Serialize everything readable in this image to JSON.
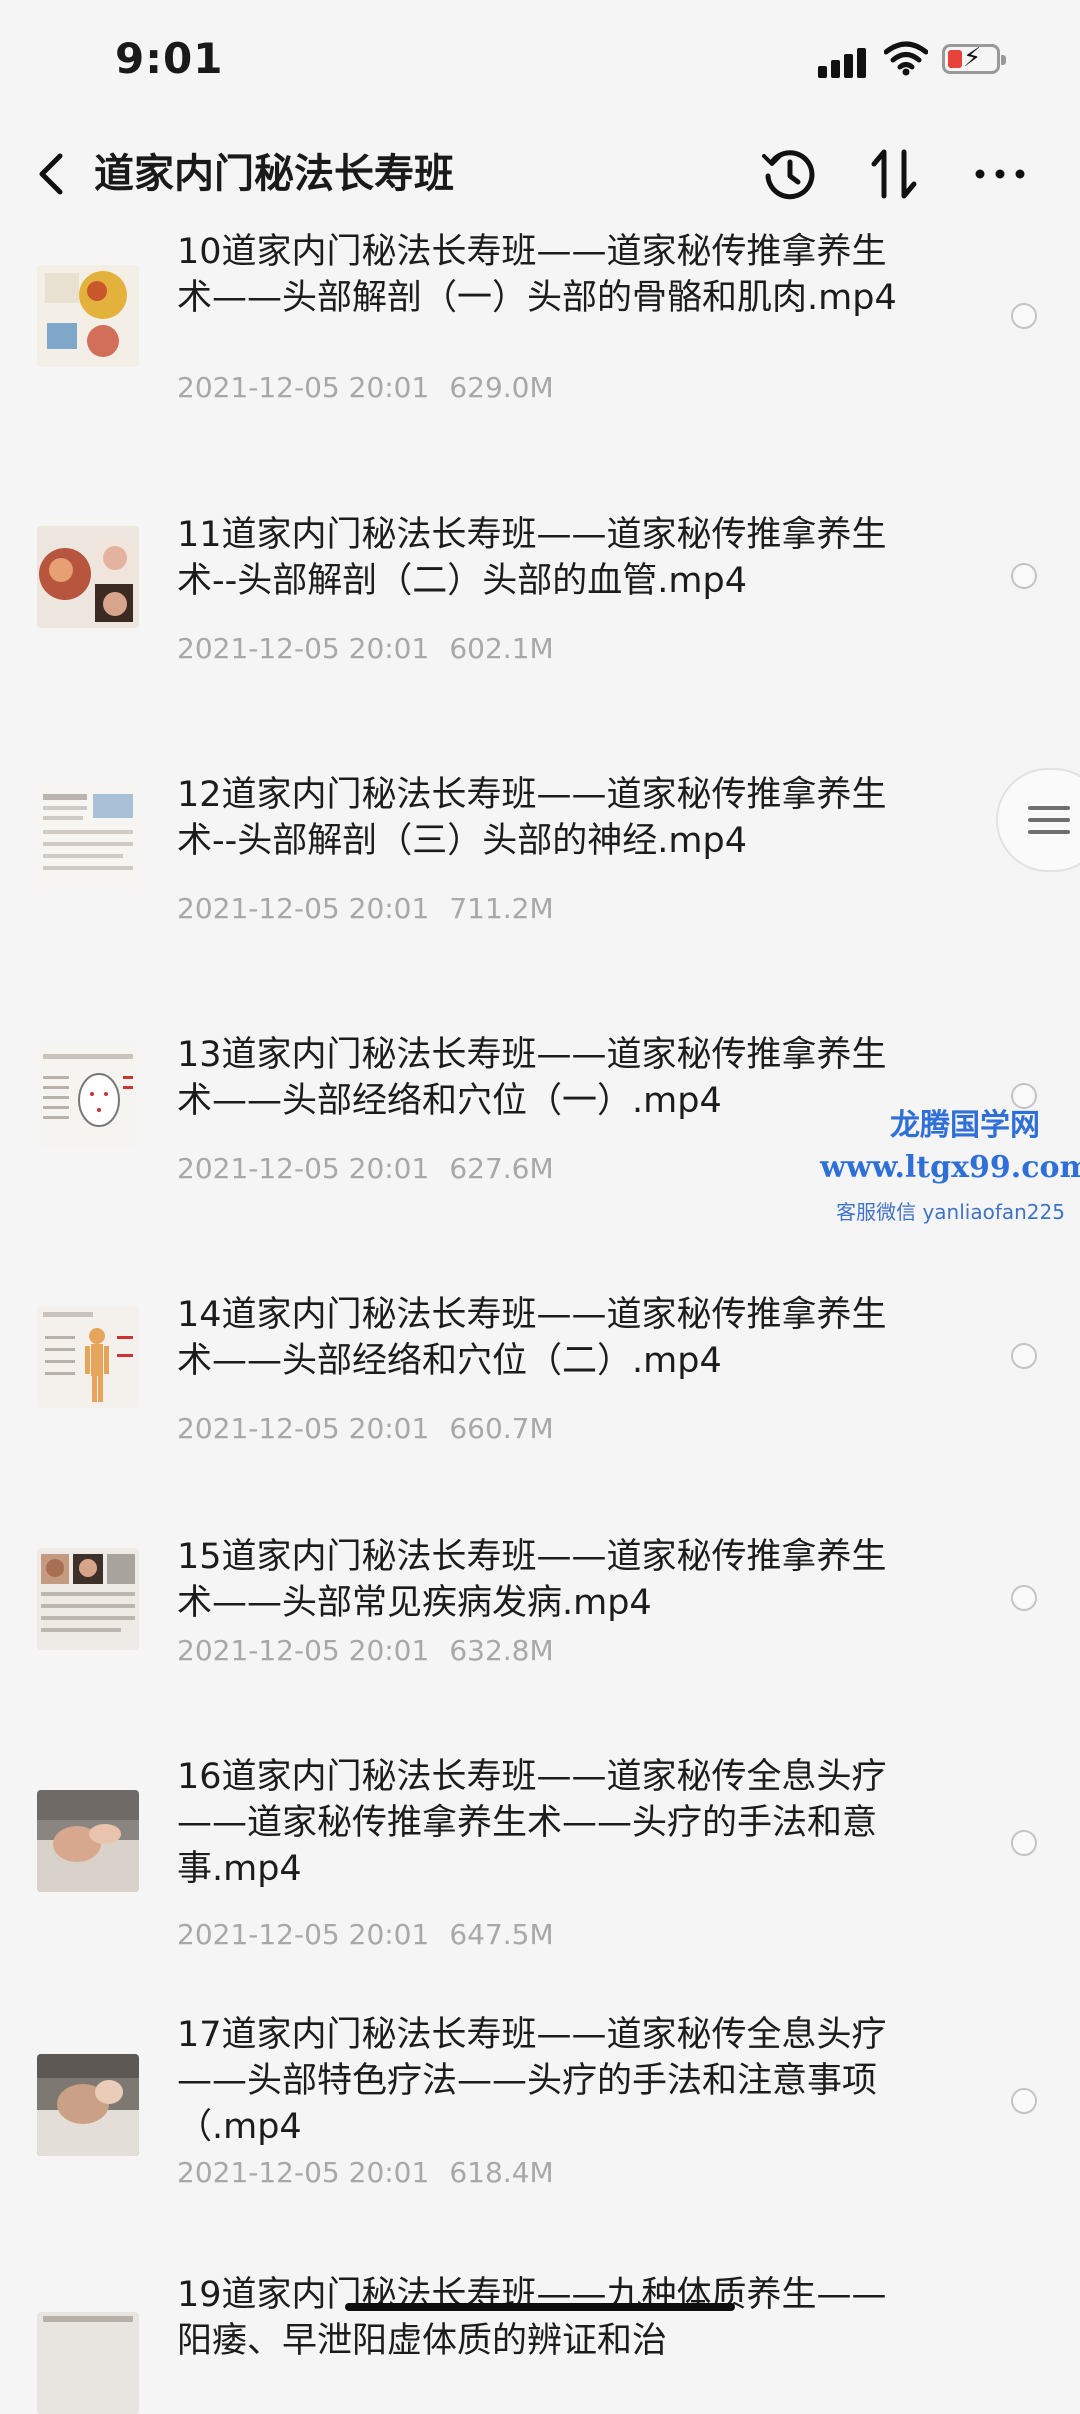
{
  "status": {
    "time": "9:01"
  },
  "nav": {
    "title": "道家内门秘法长寿班",
    "back_icon": "chevron-left-icon",
    "history_icon": "history-icon",
    "sort_icon": "sort-icon",
    "more_icon": "more-icon"
  },
  "files": [
    {
      "name": "10道家内门秘法长寿班——道家秘传推拿养生术——头部解剖（一）头部的骨骼和肌肉.mp4",
      "date": "2021-12-05 20:01",
      "size": "629.0M"
    },
    {
      "name": "11道家内门秘法长寿班——道家秘传推拿养生术--头部解剖（二）头部的血管.mp4",
      "date": "2021-12-05 20:01",
      "size": "602.1M"
    },
    {
      "name": "12道家内门秘法长寿班——道家秘传推拿养生术--头部解剖（三）头部的神经.mp4",
      "date": "2021-12-05 20:01",
      "size": "711.2M"
    },
    {
      "name": "13道家内门秘法长寿班——道家秘传推拿养生术——头部经络和穴位（一）.mp4",
      "date": "2021-12-05 20:01",
      "size": "627.6M"
    },
    {
      "name": "14道家内门秘法长寿班——道家秘传推拿养生术——头部经络和穴位（二）.mp4",
      "date": "2021-12-05 20:01",
      "size": "660.7M"
    },
    {
      "name": "15道家内门秘法长寿班——道家秘传推拿养生术——头部常见疾病发病.mp4",
      "date": "2021-12-05 20:01",
      "size": "632.8M"
    },
    {
      "name": "16道家内门秘法长寿班——道家秘传全息头疗——道家秘传推拿养生术——头疗的手法和意事.mp4",
      "date": "2021-12-05 20:01",
      "size": "647.5M"
    },
    {
      "name": "17道家内门秘法长寿班——道家秘传全息头疗——头部特色疗法——头疗的手法和注意事项（.mp4",
      "date": "2021-12-05 20:01",
      "size": "618.4M"
    },
    {
      "name": "19道家内门秘法长寿班——九种体质养生——阳痿、早泄阳虚体质的辨证和治",
      "date": "",
      "size": ""
    }
  ],
  "watermark": {
    "brand": "龙腾国学网",
    "url": "www.ltgx99.com",
    "contact": "客服微信 yanliaofan225"
  }
}
